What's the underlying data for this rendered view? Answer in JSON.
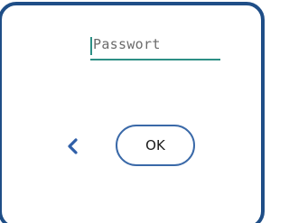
{
  "dialog": {
    "password_placeholder": "Passwort",
    "ok_label": "OK",
    "back_icon": "chevron-left-icon"
  },
  "colors": {
    "frame_border": "#1f4e87",
    "accent_teal": "#2d8f85",
    "button_border": "#3a69a8",
    "back_icon": "#2f5fa8",
    "placeholder_text": "#6b6b6b"
  }
}
